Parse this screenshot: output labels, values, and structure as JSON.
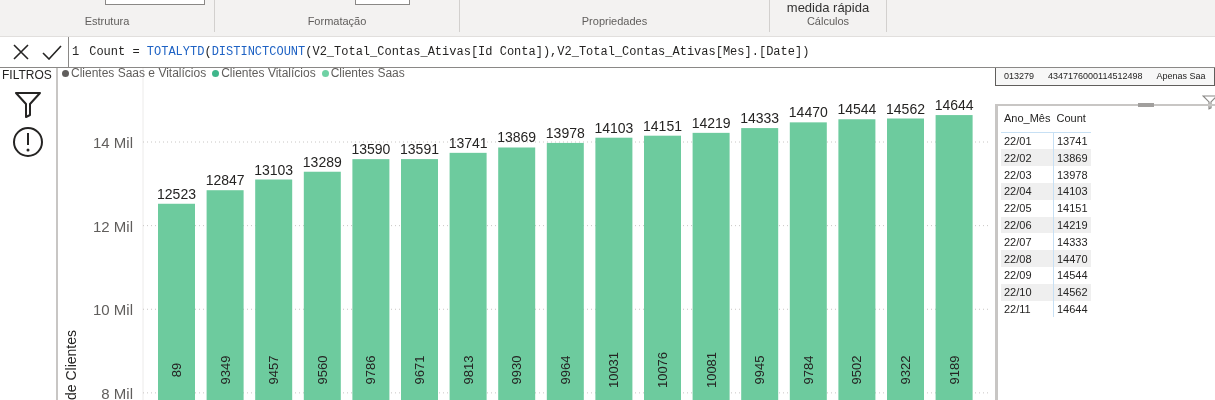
{
  "ribbon": {
    "top_button": "medida  rápida",
    "groups": [
      {
        "label": "Estrutura"
      },
      {
        "label": "Formatação"
      },
      {
        "label": "Propriedades"
      },
      {
        "label": "Cálculos"
      }
    ]
  },
  "formula_bar": {
    "line_number": "1",
    "tokens": [
      {
        "kind": "plain",
        "text": "Count = "
      },
      {
        "kind": "function",
        "text": "TOTALYTD"
      },
      {
        "kind": "plain",
        "text": "("
      },
      {
        "kind": "function",
        "text": "DISTINCTCOUNT"
      },
      {
        "kind": "plain",
        "text": "(V2_Total_Contas_Ativas[Id Conta]),V2_Total_Contas_Ativas[Mes].[Date])"
      }
    ]
  },
  "filters_pane": {
    "title": "FILTROS"
  },
  "chart": {
    "legend": [
      {
        "label": "Clientes Saas e Vitalícios",
        "color": "#605e5c"
      },
      {
        "label": "Clientes Vitalícios",
        "color": "#3fb68b"
      },
      {
        "label": "Clientes Saas",
        "color": "#6fd1a4"
      }
    ],
    "inner_labels": [
      "89",
      "9349",
      "9457",
      "9560",
      "9786",
      "9671",
      "9813",
      "9930",
      "9964",
      "10031",
      "10076",
      "10081",
      "9945",
      "9784",
      "9502",
      "9322",
      "9189"
    ],
    "chart_data": {
      "type": "bar",
      "ylabel": "de Clientes",
      "grid": true,
      "ylim": [
        7.71,
        15.77
      ],
      "yticks": [
        {
          "value": 8,
          "label": "8 Mil"
        },
        {
          "value": 10,
          "label": "10 Mil"
        },
        {
          "value": 12,
          "label": "12 Mil"
        },
        {
          "value": 14,
          "label": "14 Mil"
        }
      ],
      "value_labels": [
        "12523",
        "12847",
        "13103",
        "13289",
        "13590",
        "13591",
        "13741",
        "13869",
        "13978",
        "14103",
        "14151",
        "14219",
        "14333",
        "14470",
        "14544",
        "14562",
        "14644"
      ],
      "series": [
        {
          "color": "#6dcb9e",
          "values": [
            12.523,
            12.847,
            13.103,
            13.289,
            13.59,
            13.591,
            13.741,
            13.869,
            13.978,
            14.103,
            14.151,
            14.219,
            14.333,
            14.47,
            14.544,
            14.562,
            14.644
          ]
        }
      ]
    }
  },
  "top_table_row": [
    "013279",
    "4347176000114512498",
    "Apenas Saa"
  ],
  "table": {
    "columns": [
      "Ano_Mês",
      "Count"
    ],
    "rows": [
      [
        "22/01",
        "13741"
      ],
      [
        "22/02",
        "13869"
      ],
      [
        "22/03",
        "13978"
      ],
      [
        "22/04",
        "14103"
      ],
      [
        "22/05",
        "14151"
      ],
      [
        "22/06",
        "14219"
      ],
      [
        "22/07",
        "14333"
      ],
      [
        "22/08",
        "14470"
      ],
      [
        "22/09",
        "14544"
      ],
      [
        "22/10",
        "14562"
      ],
      [
        "22/11",
        "14644"
      ]
    ]
  }
}
